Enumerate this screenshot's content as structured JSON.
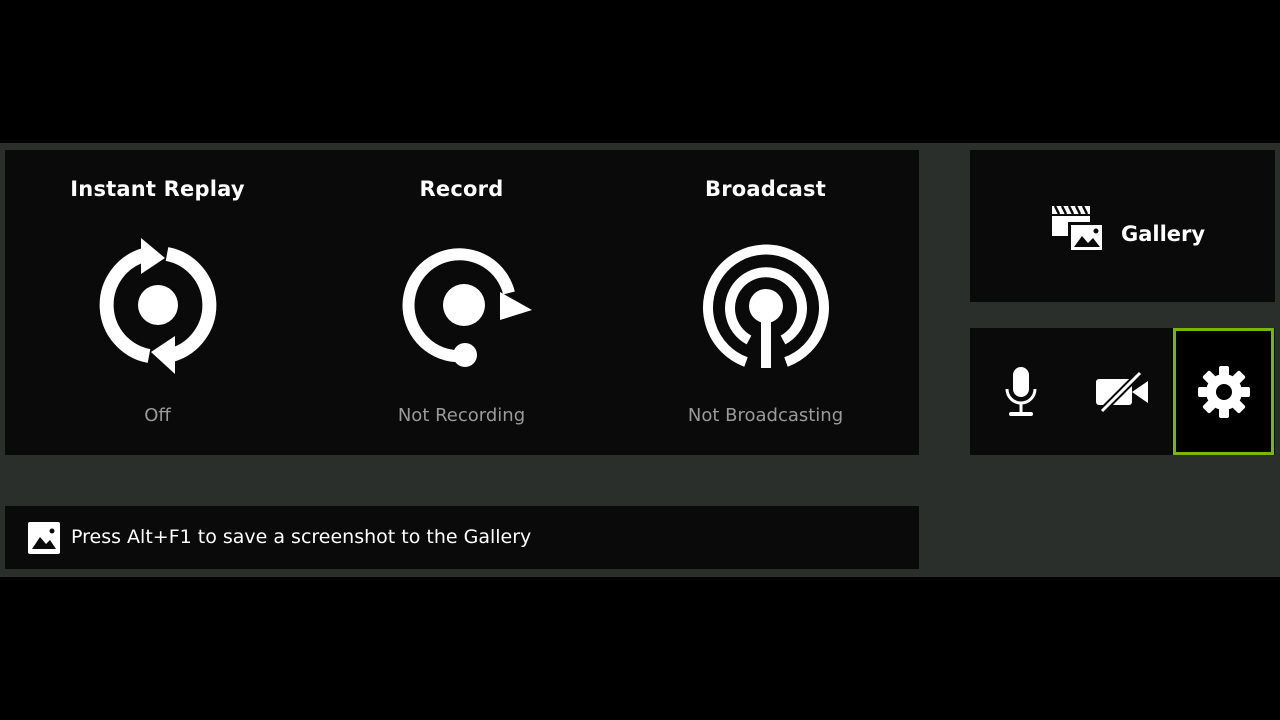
{
  "colors": {
    "accent": "#76b900",
    "panel": "#0a0a0a",
    "overlay_bg": "#2a2f2c",
    "status_text": "#9a9a9a"
  },
  "features": [
    {
      "title": "Instant Replay",
      "status": "Off",
      "icon": "instant-replay-icon"
    },
    {
      "title": "Record",
      "status": "Not Recording",
      "icon": "record-icon"
    },
    {
      "title": "Broadcast",
      "status": "Not Broadcasting",
      "icon": "broadcast-icon"
    }
  ],
  "gallery": {
    "label": "Gallery",
    "icon": "gallery-icon"
  },
  "tools": [
    {
      "icon": "microphone-icon",
      "selected": false
    },
    {
      "icon": "camera-off-icon",
      "selected": false
    },
    {
      "icon": "gear-icon",
      "selected": true
    }
  ],
  "hint": {
    "text": "Press Alt+F1 to save a screenshot to the Gallery",
    "icon": "image-icon"
  }
}
